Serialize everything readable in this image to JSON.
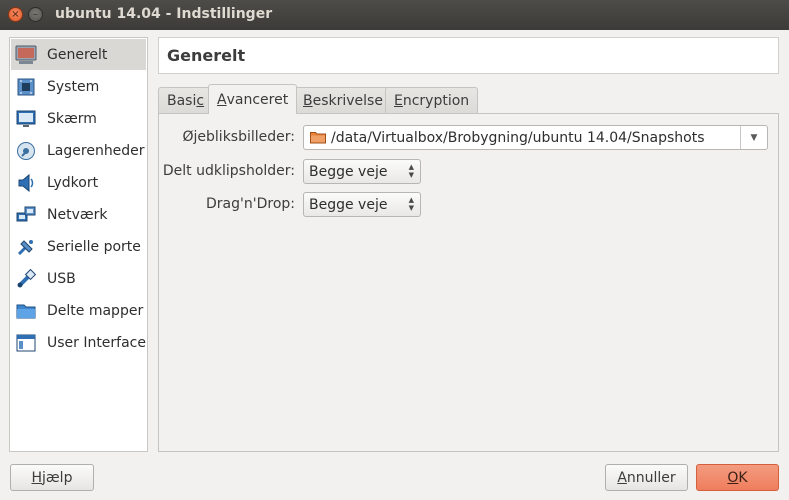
{
  "window": {
    "title": "ubuntu 14.04 - Indstillinger",
    "close_glyph": "×",
    "minimize_glyph": "–"
  },
  "sidebar": {
    "items": [
      {
        "label": "Generelt",
        "icon": "computer-icon"
      },
      {
        "label": "System",
        "icon": "chip-icon"
      },
      {
        "label": "Skærm",
        "icon": "monitor-icon"
      },
      {
        "label": "Lagerenheder",
        "icon": "disk-icon"
      },
      {
        "label": "Lydkort",
        "icon": "speaker-icon"
      },
      {
        "label": "Netværk",
        "icon": "network-icon"
      },
      {
        "label": "Serielle porte",
        "icon": "serial-port-icon"
      },
      {
        "label": "USB",
        "icon": "usb-icon"
      },
      {
        "label": "Delte mapper",
        "icon": "folder-icon"
      },
      {
        "label": "User Interface",
        "icon": "window-icon"
      }
    ],
    "active_index": 0
  },
  "header": {
    "title": "Generelt"
  },
  "tabs": [
    {
      "pre": "Basi",
      "mnemonic": "c",
      "post": ""
    },
    {
      "pre": "",
      "mnemonic": "A",
      "post": "vanceret"
    },
    {
      "pre": "",
      "mnemonic": "B",
      "post": "eskrivelse"
    },
    {
      "pre": "",
      "mnemonic": "E",
      "post": "ncryption"
    }
  ],
  "active_tab": 1,
  "form": {
    "snapshots": {
      "label": "Øjebliksbilleder:",
      "value": "/data/Virtualbox/Brobygning/ubuntu 14.04/Snapshots"
    },
    "clipboard": {
      "label": "Delt udklipsholder:",
      "value": "Begge veje"
    },
    "dragdrop": {
      "label": "Drag'n'Drop:",
      "value": "Begge veje"
    }
  },
  "buttons": {
    "help": {
      "pre": "",
      "mnemonic": "H",
      "post": "jælp"
    },
    "cancel": {
      "pre": "",
      "mnemonic": "A",
      "post": "nnuller"
    },
    "ok": {
      "pre": "",
      "mnemonic": "O",
      "post": "K"
    }
  },
  "colors": {
    "accent_ok": "#ef7e5d",
    "folder": "#e8823c",
    "close_button": "#e25b2a"
  }
}
